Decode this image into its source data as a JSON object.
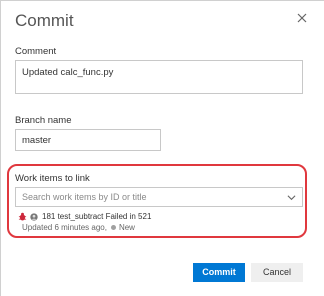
{
  "dialog": {
    "title": "Commit",
    "close_icon": "close-icon"
  },
  "comment": {
    "label": "Comment",
    "value": "Updated calc_func.py"
  },
  "branch": {
    "label": "Branch name",
    "value": "master"
  },
  "work_items": {
    "label": "Work items to link",
    "search_placeholder": "Search work items by ID or title",
    "items": [
      {
        "type_icon": "bug-icon",
        "avatar_icon": "avatar-icon",
        "title_line": "181 test_subtract Failed in 521",
        "updated": "Updated 6 minutes ago,",
        "state": "New",
        "state_color": "#a0a0a0"
      }
    ],
    "highlight_color": "#e0383e"
  },
  "buttons": {
    "commit": "Commit",
    "cancel": "Cancel"
  },
  "colors": {
    "primary": "#0078d4",
    "bug": "#cc293d"
  }
}
